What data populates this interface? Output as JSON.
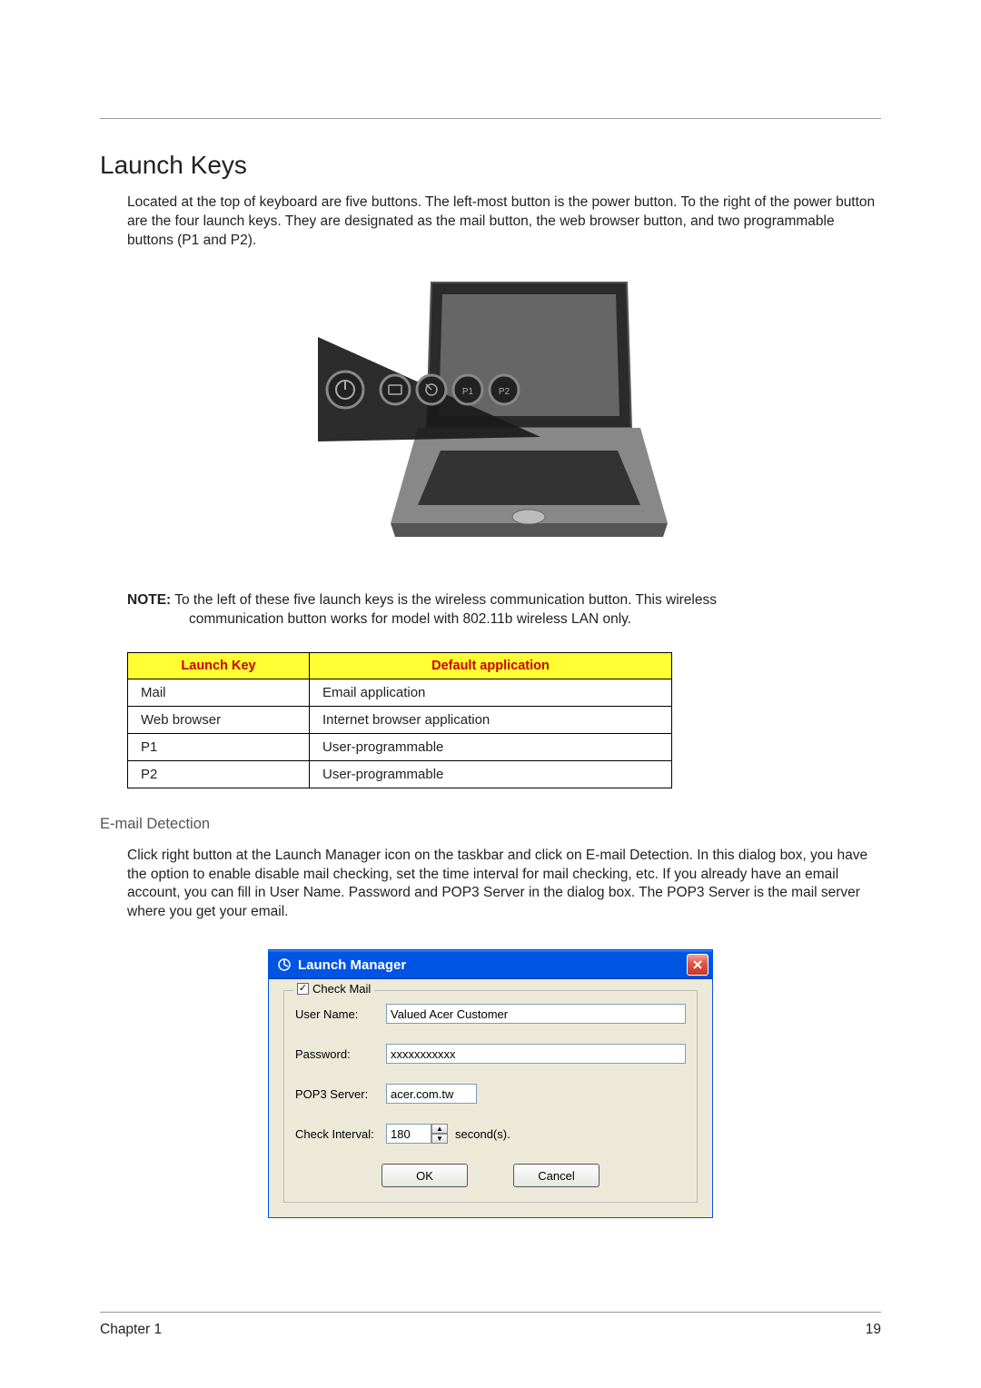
{
  "section_title": "Launch Keys",
  "intro_text": "Located at the top of keyboard are five buttons. The left-most button is the power button. To the right of the power button are the four launch keys. They are designated as the mail button, the web browser button, and two programmable buttons (P1 and P2).",
  "note_label": "NOTE:",
  "note_text_line1": " To the left of these five launch keys is the wireless communication button. This wireless",
  "note_text_line2": "communication button works for model with 802.11b wireless LAN only.",
  "table": {
    "headers": [
      "Launch Key",
      "Default application"
    ],
    "rows": [
      [
        "Mail",
        "Email application"
      ],
      [
        "Web browser",
        "Internet browser application"
      ],
      [
        "P1",
        "User-programmable"
      ],
      [
        "P2",
        "User-programmable"
      ]
    ]
  },
  "subsection_title": "E-mail Detection",
  "subsection_text": "Click right button at the Launch Manager icon on the taskbar and click on E-mail Detection. In this dialog box, you have the option to enable disable mail checking, set the time interval for mail checking, etc. If you already have an email account, you can fill in User Name. Password and POP3 Server in the dialog box. The POP3 Server is the mail server where you get your email.",
  "dialog": {
    "title": "Launch Manager",
    "check_mail_label": "Check Mail",
    "user_name_label": "User Name:",
    "user_name_value": "Valued Acer Customer",
    "password_label": "Password:",
    "password_value": "xxxxxxxxxxx",
    "pop3_label": "POP3 Server:",
    "pop3_value": "acer.com.tw",
    "interval_label": "Check Interval:",
    "interval_value": "180",
    "interval_unit": "second(s).",
    "ok_label": "OK",
    "cancel_label": "Cancel"
  },
  "footer": {
    "chapter": "Chapter 1",
    "page": "19"
  }
}
